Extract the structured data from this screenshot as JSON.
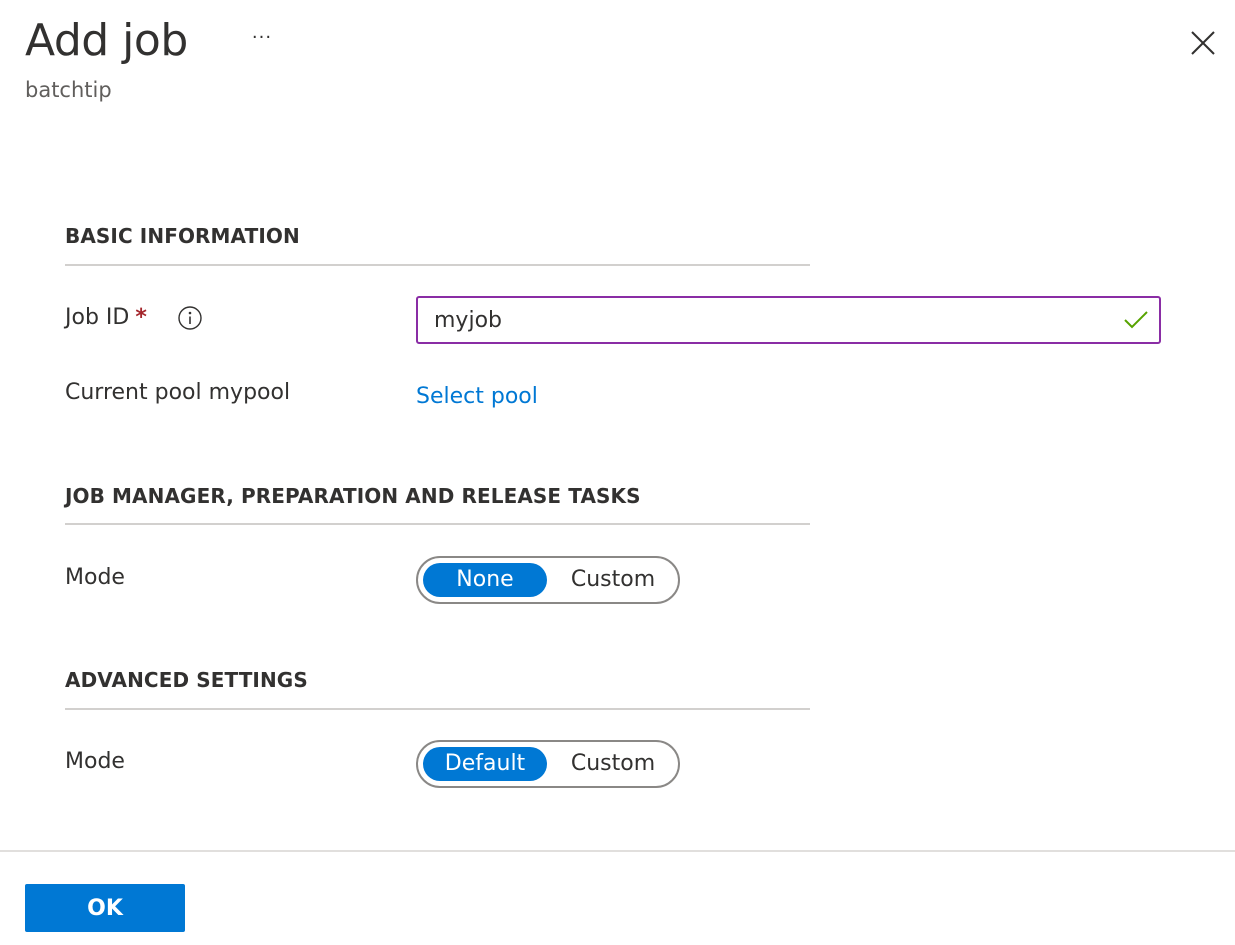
{
  "header": {
    "title": "Add job",
    "subtitle": "batchtip",
    "more_icon": "more-ellipsis-icon",
    "more_label": "···",
    "close_icon": "close-icon"
  },
  "sections": {
    "basic": {
      "heading": "BASIC INFORMATION",
      "job_id": {
        "label": "Job ID",
        "required_marker": "*",
        "info_icon": "info-icon",
        "value": "myjob",
        "valid_icon": "checkmark-icon"
      },
      "pool": {
        "label": "Current pool mypool",
        "link": "Select pool"
      }
    },
    "tasks": {
      "heading": "JOB MANAGER, PREPARATION AND RELEASE TASKS",
      "mode_label": "Mode",
      "options": [
        "None",
        "Custom"
      ],
      "selected": "None"
    },
    "advanced": {
      "heading": "ADVANCED SETTINGS",
      "mode_label": "Mode",
      "options": [
        "Default",
        "Custom"
      ],
      "selected": "Default"
    }
  },
  "footer": {
    "ok_label": "OK"
  },
  "colors": {
    "accent": "#0078d4",
    "input_border": "#8a2da5",
    "valid": "#57a300",
    "required": "#a4262c"
  }
}
